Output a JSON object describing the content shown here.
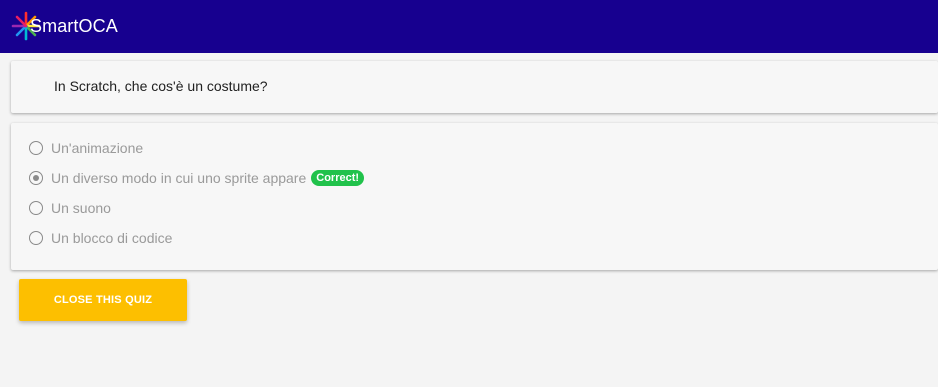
{
  "app": {
    "brand": "SmartOCA",
    "header_color": "#17008f"
  },
  "quiz": {
    "question": "In Scratch, che cos'è un costume?",
    "options": [
      {
        "label": "Un'animazione",
        "selected": false
      },
      {
        "label": "Un diverso modo in cui uno sprite appare",
        "selected": true,
        "feedback": "Correct!"
      },
      {
        "label": "Un suono",
        "selected": false
      },
      {
        "label": "Un blocco di codice",
        "selected": false
      }
    ],
    "close_label": "CLOSE THIS QUIZ"
  },
  "colors": {
    "correct_badge": "#21c24b",
    "close_button": "#fdbf00"
  },
  "icons": {
    "logo": "smartoca-logo-icon"
  }
}
